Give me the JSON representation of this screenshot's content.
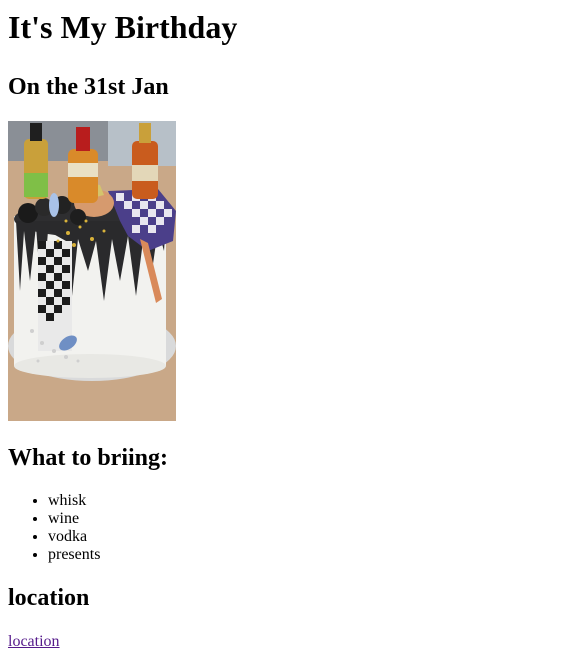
{
  "page": {
    "title": "It's My Birthday",
    "date": "On the 31st Jan",
    "bring_heading": "What to briing:",
    "bring_items": [
      "whisk",
      "wine",
      "vodka",
      "presents"
    ],
    "location_heading": "location",
    "location_link": "location"
  },
  "image": {
    "description_icon": "birthday-cake-photo"
  },
  "colors": {
    "link_visited": "#551a8b",
    "text": "#000000",
    "background": "#ffffff"
  }
}
